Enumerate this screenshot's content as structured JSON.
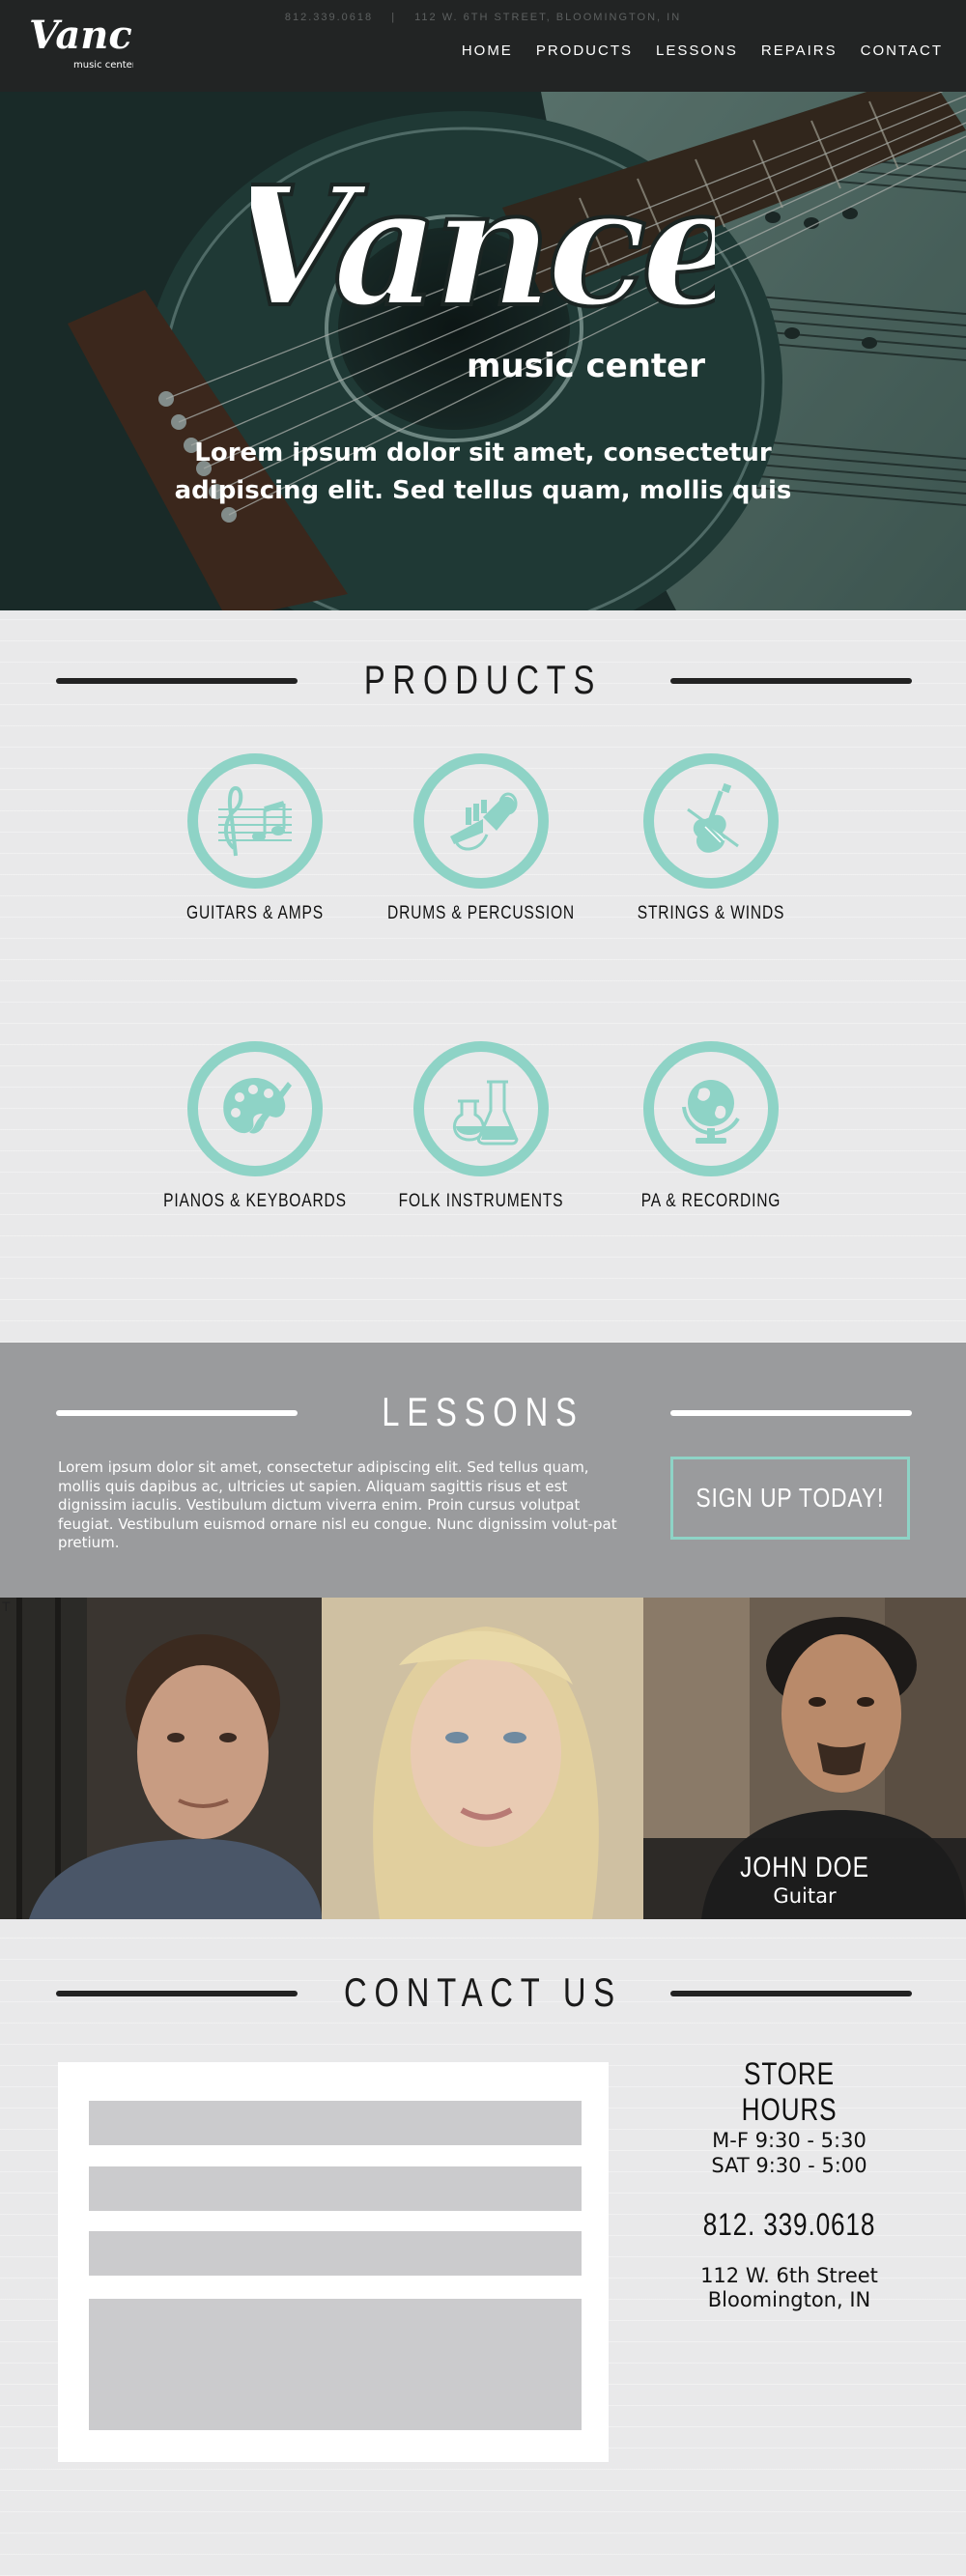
{
  "header": {
    "logo_text": "Vance",
    "logo_subtext": "music center",
    "phone": "812.339.0618",
    "separator": "|",
    "address": "112 W. 6TH STREET, BLOOMINGTON, IN",
    "nav": [
      {
        "label": "HOME"
      },
      {
        "label": "PRODUCTS"
      },
      {
        "label": "LESSONS"
      },
      {
        "label": "REPAIRS"
      },
      {
        "label": "CONTACT"
      }
    ]
  },
  "hero": {
    "logo_text": "Vance",
    "logo_subtext": "music center",
    "tagline_line1": "Lorem ipsum dolor sit amet, consectetur",
    "tagline_line2": "adipiscing elit. Sed tellus quam, mollis quis"
  },
  "products": {
    "heading": "PRODUCTS",
    "items": [
      {
        "label": "GUITARS & AMPS",
        "icon": "music-notes-icon"
      },
      {
        "label": "DRUMS & PERCUSSION",
        "icon": "trumpet-icon"
      },
      {
        "label": "STRINGS & WINDS",
        "icon": "violin-icon"
      },
      {
        "label": "PIANOS & KEYBOARDS",
        "icon": "palette-icon"
      },
      {
        "label": "FOLK INSTRUMENTS",
        "icon": "flasks-icon"
      },
      {
        "label": "PA & RECORDING",
        "icon": "globe-icon"
      }
    ]
  },
  "lessons": {
    "heading": "LESSONS",
    "body": "Lorem ipsum dolor sit amet, consectetur adipiscing elit. Sed tellus quam, mollis quis dapibus ac, ultricies ut sapien. Aliquam sagittis risus et est dignissim iaculis. Vestibulum dictum viverra enim. Proin cursus volutpat feugiat. Vestibulum euismod ornare nisl eu congue. Nunc dignissim volut-pat pretium.",
    "cta_label": "SIGN UP TODAY!",
    "teacher": {
      "name": "JOHN DOE",
      "instrument": "Guitar"
    },
    "cursor_glyph": "T"
  },
  "contact": {
    "heading": "CONTACT US",
    "hours_title": "STORE HOURS",
    "hours": [
      "M-F 9:30 - 5:30",
      "SAT 9:30 - 5:00"
    ],
    "phone": "812. 339.0618",
    "address_line1": "112 W. 6th Street",
    "address_line2": "Bloomington, IN"
  },
  "colors": {
    "accent": "#8ed3c6",
    "header_bg": "#222424",
    "lessons_bg": "#9a9b9d",
    "page_bg": "#e9e9ea",
    "field_bg": "#cbcbcd"
  }
}
